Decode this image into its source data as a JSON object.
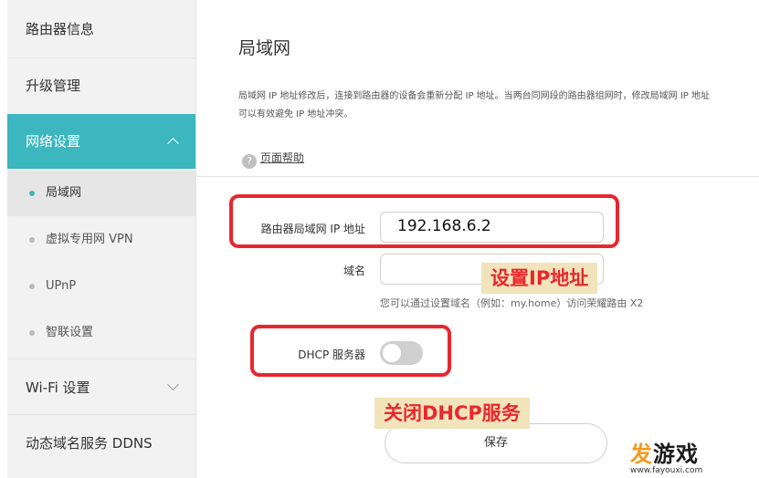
{
  "sidebar": {
    "top_items": [
      {
        "label": "路由器信息"
      },
      {
        "label": "升级管理"
      }
    ],
    "active_section": {
      "label": "网络设置"
    },
    "sub_items": [
      {
        "label": "局域网"
      },
      {
        "label": "虚拟专用网 VPN"
      },
      {
        "label": "UPnP"
      },
      {
        "label": "智联设置"
      }
    ],
    "bottom_items": [
      {
        "label": "Wi-Fi 设置"
      },
      {
        "label": "动态域名服务 DDNS"
      }
    ]
  },
  "main": {
    "title": "局域网",
    "description_line1": "局域网 IP 地址修改后，连接到路由器的设备会重新分配 IP 地址。当两台同网段的路由器组网时，修改局域网 IP 地址",
    "description_line2": "可以有效避免 IP 地址冲突。",
    "help_label": "页面帮助",
    "help_icon": "?",
    "ip_label": "路由器局域网 IP 地址",
    "ip_value": "192.168.6.2",
    "domain_label": "域名",
    "domain_value": "",
    "domain_hint": "您可以通过设置域名（例如：my.home）访问荣耀路由 X2",
    "dhcp_label": "DHCP 服务器",
    "dhcp_enabled": false,
    "save_label": "保存"
  },
  "annotations": {
    "caption_ip": "设置IP地址",
    "caption_dhcp": "关闭DHCP服务"
  },
  "watermark": {
    "brand_part1": "发",
    "brand_part2": "游戏",
    "url": "www.fayouxi.com"
  },
  "colors": {
    "accent": "#3cb6bf",
    "annotation_red": "#e8272e",
    "caption_bg": "#f1e4ba"
  }
}
